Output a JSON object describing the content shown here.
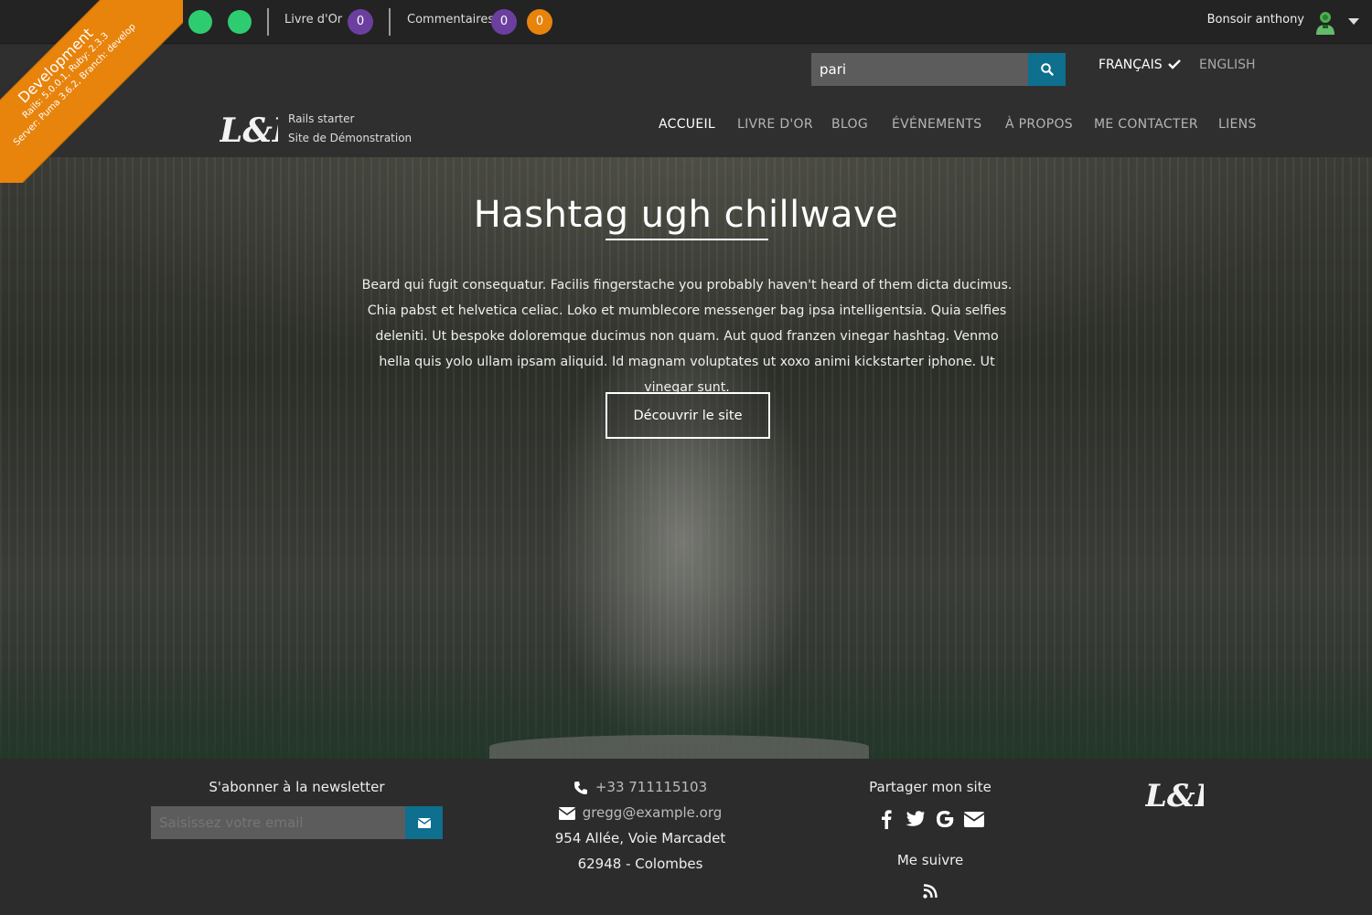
{
  "dev_ribbon": {
    "env": "Development",
    "line2": "Rails: 5.0.0.1, Ruby: 2.3.3",
    "line3": "Server: Puma 3.6.2, Branch: develop",
    "color": "#e8830c"
  },
  "admin_bar": {
    "guestbook_label": "Livre d'Or",
    "guestbook_count": "0",
    "comments_label": "Commentaires",
    "comments_count": "0",
    "comments_pending": "0",
    "greeting": "Bonsoir anthony"
  },
  "search": {
    "value": "pari"
  },
  "languages": {
    "fr": "FRANÇAIS",
    "en": "ENGLISH"
  },
  "brand": {
    "line1": "Rails starter",
    "line2": "Site de Démonstration"
  },
  "nav": {
    "items": [
      "ACCUEIL",
      "LIVRE D'OR",
      "BLOG",
      "ÉVÉNEMENTS",
      "À PROPOS",
      "ME CONTACTER",
      "LIENS"
    ]
  },
  "hero": {
    "title": "Hashtag ugh chillwave",
    "text": "Beard qui fugit consequatur. Facilis fingerstache you probably haven't heard of them dicta ducimus. Chia pabst et helvetica celiac. Loko et mumblecore messenger bag ipsa intelligentsia. Quia selfies deleniti. Ut bespoke doloremque ducimus non quam. Aut quod franzen vinegar hashtag. Venmo hella quis yolo ullam ipsam aliquid. Id magnam voluptates ut xoxo animi kickstarter iphone. Ut vinegar sunt.",
    "button": "Découvrir le site"
  },
  "footer": {
    "newsletter_title": "S'abonner à la newsletter",
    "newsletter_placeholder": "Saisissez votre email",
    "phone": "+33 711115103",
    "email": "gregg@example.org",
    "address": "954 Allée, Voie Marcadet",
    "city": "62948 - Colombes",
    "share_title": "Partager mon site",
    "follow_title": "Me suivre"
  },
  "colors": {
    "accent": "#0e6f8f",
    "status_green": "#2ecc71",
    "badge_purple": "#6b3fa0",
    "badge_orange": "#e8830c"
  }
}
